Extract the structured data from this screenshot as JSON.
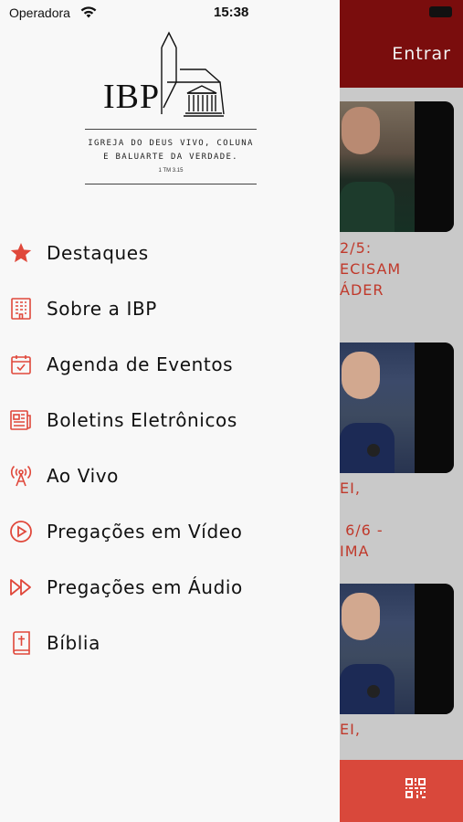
{
  "status_bar": {
    "carrier": "Operadora",
    "time": "15:38"
  },
  "logo": {
    "text": "IBP",
    "motto_line1": "IGREJA DO DEUS VIVO, COLUNA",
    "motto_line2": "E BALUARTE DA VERDADE.",
    "reference": "1 TM 3.15"
  },
  "menu": {
    "items": [
      {
        "label": "Destaques",
        "icon": "star-icon"
      },
      {
        "label": "Sobre a IBP",
        "icon": "building-icon"
      },
      {
        "label": "Agenda de Eventos",
        "icon": "calendar-check-icon"
      },
      {
        "label": "Boletins Eletrônicos",
        "icon": "newspaper-icon"
      },
      {
        "label": "Ao Vivo",
        "icon": "broadcast-icon"
      },
      {
        "label": "Pregações em Vídeo",
        "icon": "play-circle-icon"
      },
      {
        "label": "Pregações em Áudio",
        "icon": "fast-forward-icon"
      },
      {
        "label": "Bíblia",
        "icon": "bible-icon"
      }
    ]
  },
  "background": {
    "header_action": "Entrar",
    "card_titles": [
      "2/5:\nECISAM\nÁDER",
      "EI,\n\n 6/6 -\nIMA",
      "EI,"
    ]
  },
  "colors": {
    "accent": "#e0483b",
    "header": "#7a0d0d",
    "tabbar": "#d9483b"
  }
}
